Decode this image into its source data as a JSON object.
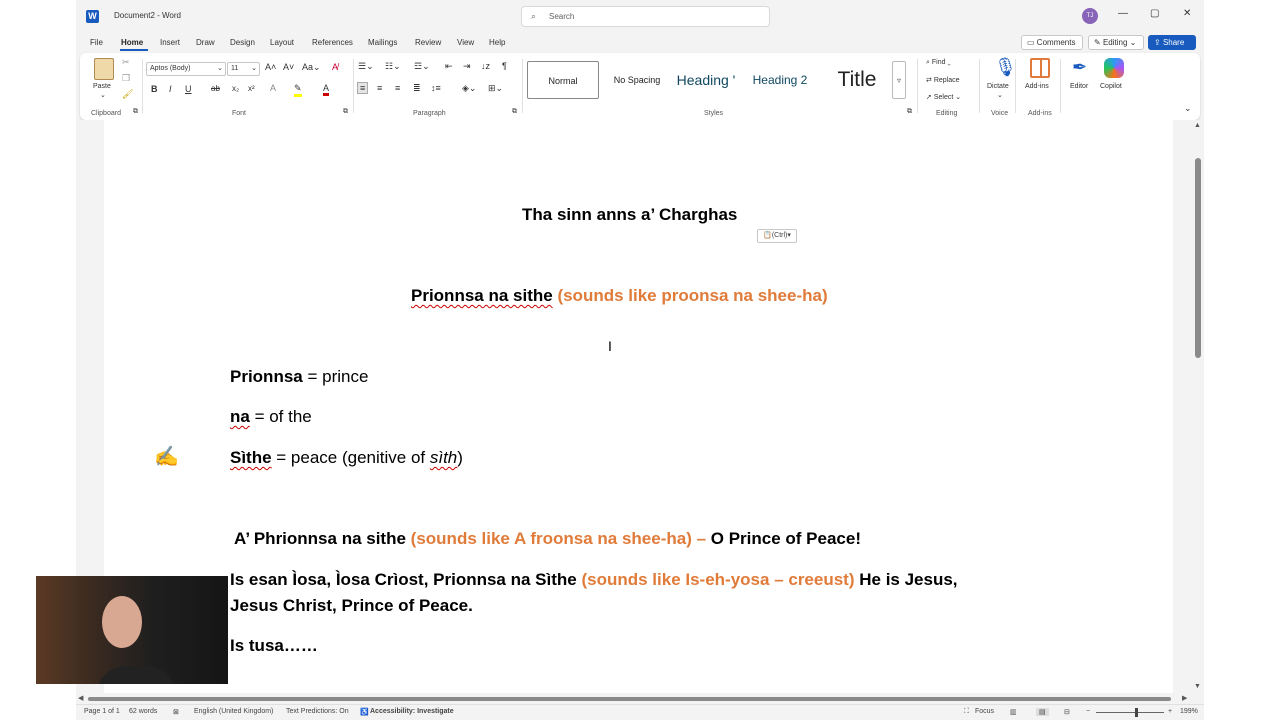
{
  "window": {
    "app_icon": "word-icon",
    "title": "Document2  -  Word",
    "search_placeholder": "Search",
    "user_initials": "TJ",
    "controls": {
      "minimize": "—",
      "restore": "▢",
      "close": "✕"
    }
  },
  "menu": {
    "items": [
      "File",
      "Home",
      "Insert",
      "Draw",
      "Design",
      "Layout",
      "References",
      "Mailings",
      "Review",
      "View",
      "Help"
    ],
    "active": "Home",
    "comments_label": "Comments",
    "editing_label": "Editing",
    "share_label": "Share"
  },
  "ribbon": {
    "clipboard": {
      "paste_label": "Paste",
      "group_label": "Clipboard"
    },
    "font": {
      "font_name": "Aptos (Body)",
      "font_size": "11",
      "group_label": "Font"
    },
    "paragraph": {
      "group_label": "Paragraph"
    },
    "styles": {
      "items": [
        "Normal",
        "No Spacing",
        "Heading 1",
        "Heading 2",
        "Title"
      ],
      "display": [
        "Normal",
        "No Spacing",
        "Heading '",
        "Heading 2",
        "Title"
      ],
      "group_label": "Styles"
    },
    "editing": {
      "find_label": "Find",
      "replace_label": "Replace",
      "select_label": "Select",
      "group_label": "Editing"
    },
    "voice": {
      "dictate_label": "Dictate",
      "group_label": "Voice"
    },
    "addins": {
      "addins_label": "Add-ins",
      "group_label": "Add-ins"
    },
    "editor_label": "Editor",
    "copilot_label": "Copilot"
  },
  "document": {
    "title": "Tha sinn anns a’ Charghas",
    "paste_options": "(Ctrl)",
    "heading_gaelic": "Prionnsa na sithe",
    "heading_pron": "(sounds like proonsa na shee-ha)",
    "vocab": [
      {
        "word": "Prionnsa",
        "meaning": " = prince"
      },
      {
        "word": "na",
        "meaning": " = of the"
      },
      {
        "word": "Sìthe",
        "meaning": " = peace (genitive of ",
        "italic": "sìth",
        "close": ")"
      }
    ],
    "line1": {
      "gaelic": "A’ Phrionnsa na sithe",
      "pron": "(sounds like A froonsa na shee-ha) –",
      "english": "O Prince of Peace!"
    },
    "line2": {
      "gaelic": "Is esan Ìosa, Ìosa Crìost,  Prionnsa na Sìthe",
      "pron": "(sounds like Is-eh-yosa – creeust)",
      "english_a": "He is Jesus,",
      "english_b": "Jesus Christ, Prince of Peace."
    },
    "line3": "Is tusa……"
  },
  "status": {
    "page": "Page 1 of 1",
    "words": "62 words",
    "language": "English (United Kingdom)",
    "predictions": "Text Predictions: On",
    "accessibility": "Accessibility: Investigate",
    "focus": "Focus",
    "zoom": "199%"
  },
  "colors": {
    "accent": "#185abd",
    "pronunciation": "#e07b39",
    "avatar": "#8764b8"
  }
}
